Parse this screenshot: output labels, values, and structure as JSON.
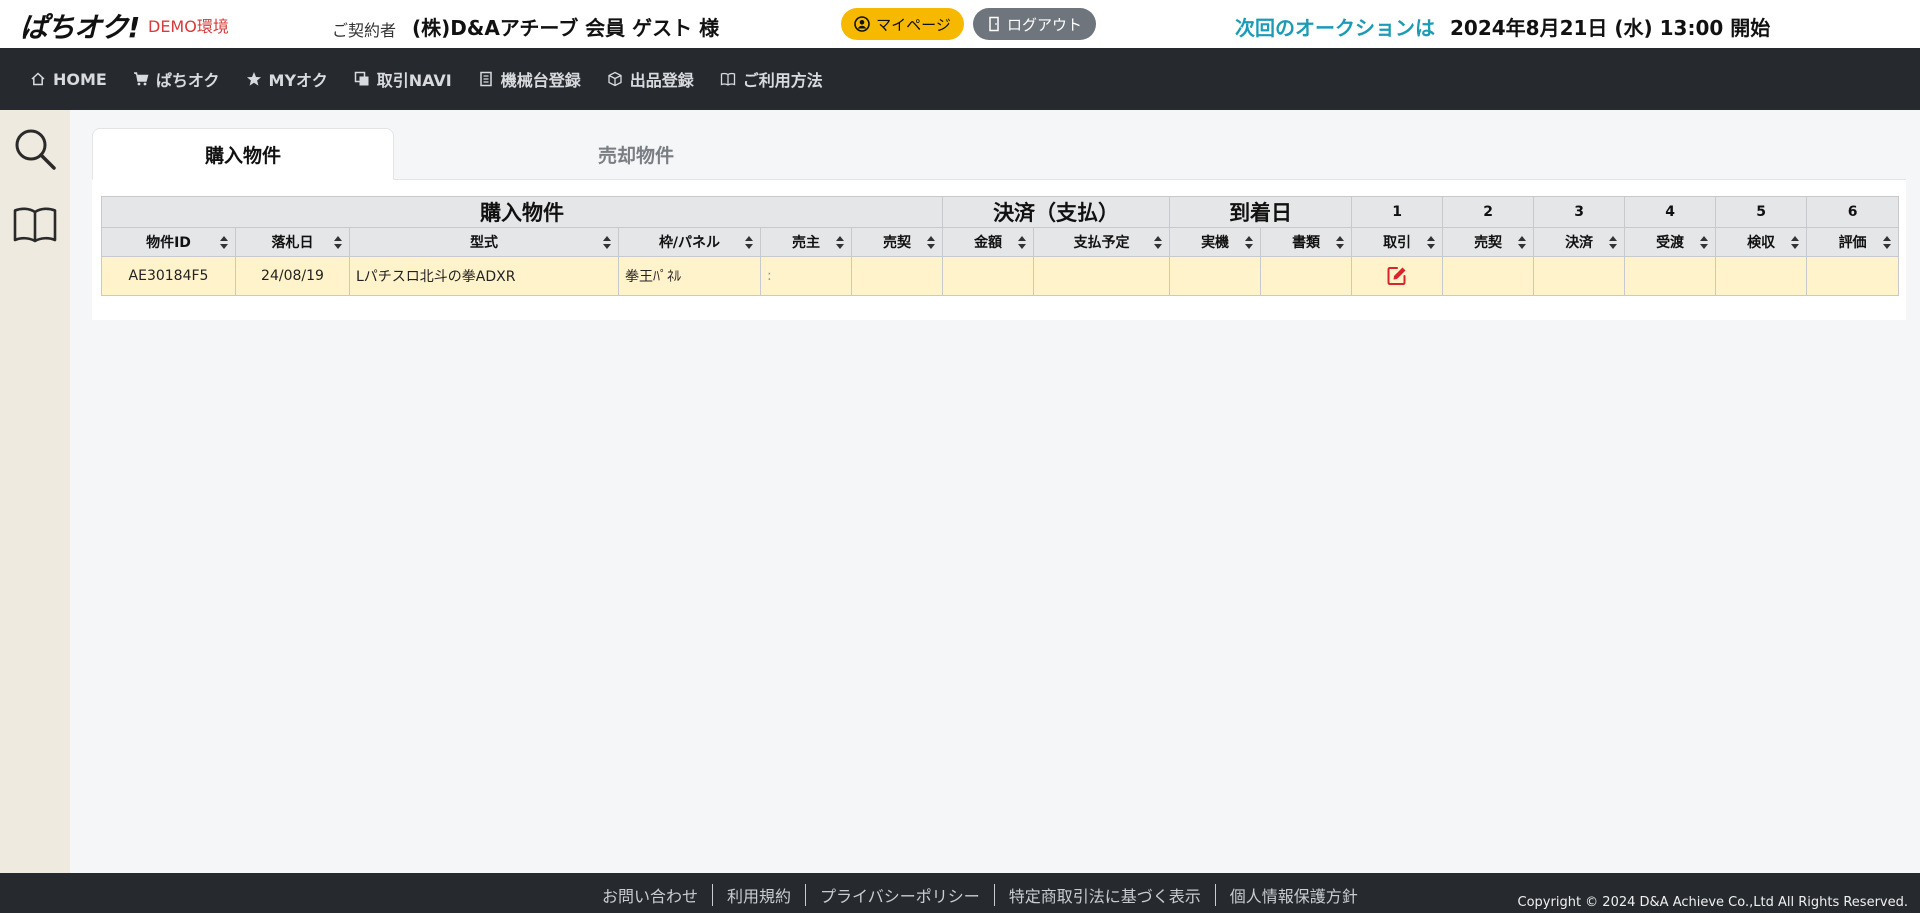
{
  "header": {
    "logo": "ぱちオク!",
    "demo_label": "DEMO環境",
    "contract_label": "ご契約者",
    "contract_name": "(株)D&Aアチーブ 会員 ゲスト 様",
    "mypage_label": "マイページ",
    "logout_label": "ログアウト",
    "next_auction_label": "次回のオークションは",
    "next_auction_date": "2024年8月21日 (水) 13:00 開始",
    "colors": {
      "accent_yellow": "#f7b900",
      "accent_cyan": "#1d9bb6",
      "demo_red": "#d63a3a"
    }
  },
  "nav": {
    "items": [
      {
        "label": "HOME",
        "icon": "home-icon"
      },
      {
        "label": "ぱちオク",
        "icon": "cart-icon"
      },
      {
        "label": "MYオク",
        "icon": "star-icon"
      },
      {
        "label": "取引NAVI",
        "icon": "copy-icon"
      },
      {
        "label": "機械台登録",
        "icon": "document-icon"
      },
      {
        "label": "出品登録",
        "icon": "box-icon"
      },
      {
        "label": "ご利用方法",
        "icon": "book-icon"
      }
    ]
  },
  "rail": {
    "icons": [
      "search-icon",
      "book-icon"
    ]
  },
  "tabs": [
    {
      "label": "購入物件",
      "active": true
    },
    {
      "label": "売却物件",
      "active": false
    }
  ],
  "table": {
    "groups": [
      {
        "label": "購入物件",
        "span": 6
      },
      {
        "label": "決済（支払）",
        "span": 2
      },
      {
        "label": "到着日",
        "span": 2
      },
      {
        "label": "1",
        "span": 1
      },
      {
        "label": "2",
        "span": 1
      },
      {
        "label": "3",
        "span": 1
      },
      {
        "label": "4",
        "span": 1
      },
      {
        "label": "5",
        "span": 1
      },
      {
        "label": "6",
        "span": 1
      }
    ],
    "columns": [
      "物件ID",
      "落札日",
      "型式",
      "枠/パネル",
      "売主",
      "売契",
      "金額",
      "支払予定",
      "実機",
      "書類",
      "取引",
      "売契",
      "決済",
      "受渡",
      "検収",
      "評価"
    ],
    "rows": [
      {
        "id": "AE30184F5",
        "date": "24/08/19",
        "model": "Lパチスロ北斗の拳ADXR",
        "frame": "拳王ﾊﾟﾈﾙ",
        "seller": ":",
        "seller_contract": "",
        "amount": "",
        "payment_schedule": "",
        "actual": "",
        "documents": "",
        "step1_icon": "edit-icon",
        "step2": "",
        "step3": "",
        "step4": "",
        "step5": "",
        "step6": ""
      }
    ]
  },
  "footer": {
    "links": [
      "お問い合わせ",
      "利用規約",
      "プライバシーポリシー",
      "特定商取引法に基づく表示",
      "個人情報保護方針"
    ],
    "copyright": "Copyright © 2024 D&A Achieve Co.,Ltd All Rights Reserved."
  }
}
